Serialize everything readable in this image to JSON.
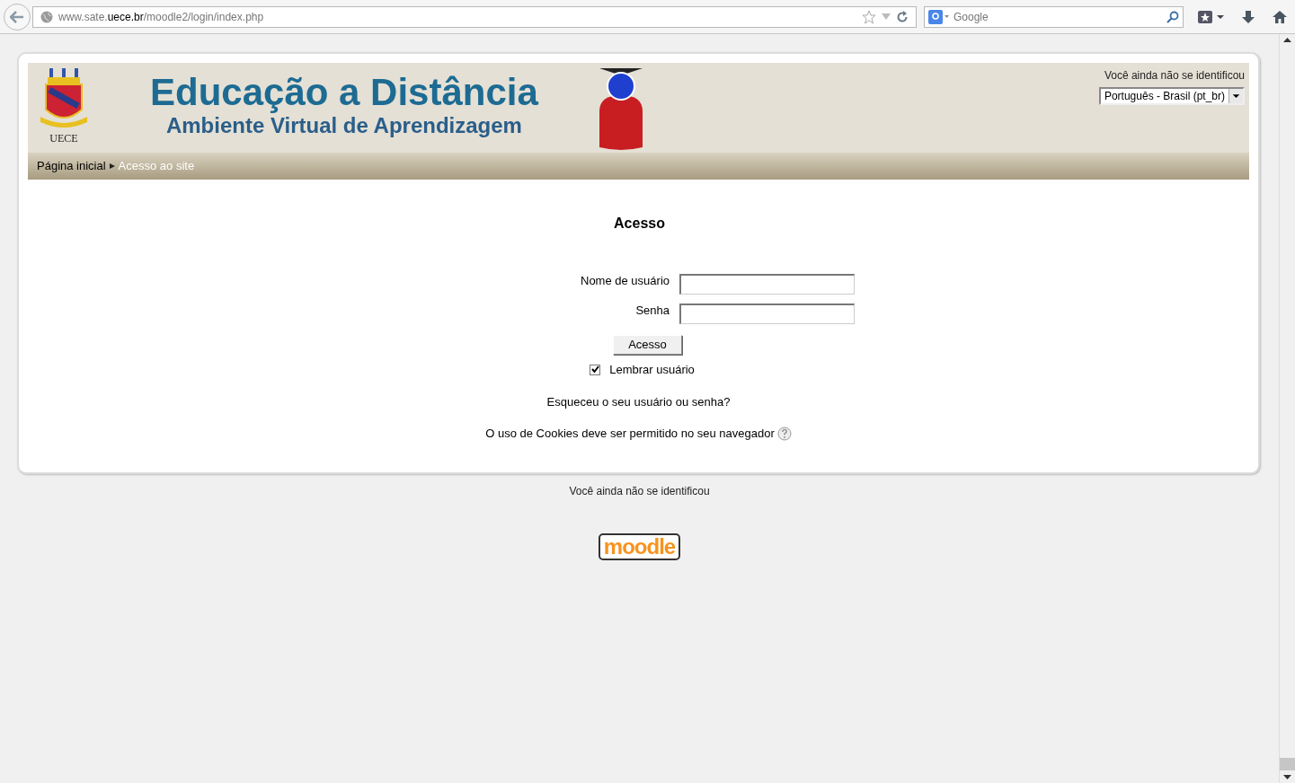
{
  "browser": {
    "url_host_prefix": "www.sate.",
    "url_host_domain": "uece.br",
    "url_path": "/moodle2/login/index.php",
    "search_placeholder": "Google"
  },
  "header": {
    "crest_label": "UECE",
    "title": "Educação a Distância",
    "subtitle": "Ambiente Virtual de Aprendizagem",
    "login_info": "Você ainda não se identificou",
    "language": "Português - Brasil (pt_br)"
  },
  "breadcrumb": [
    {
      "label": "Página inicial",
      "current": false
    },
    {
      "label": "Acesso ao site",
      "current": true
    }
  ],
  "login": {
    "heading": "Acesso",
    "fields": [
      {
        "label": "Nome de usuário"
      },
      {
        "label": "Senha"
      }
    ],
    "button": "Acesso",
    "remember": {
      "label": "Lembrar usuário",
      "checked": true
    },
    "forgot_link": "Esqueceu o seu usuário ou senha?",
    "cookies_note": "O uso de Cookies deve ser permitido no seu navegador"
  },
  "footer": {
    "login_info": "Você ainda não se identificou",
    "logo": "moodle"
  }
}
